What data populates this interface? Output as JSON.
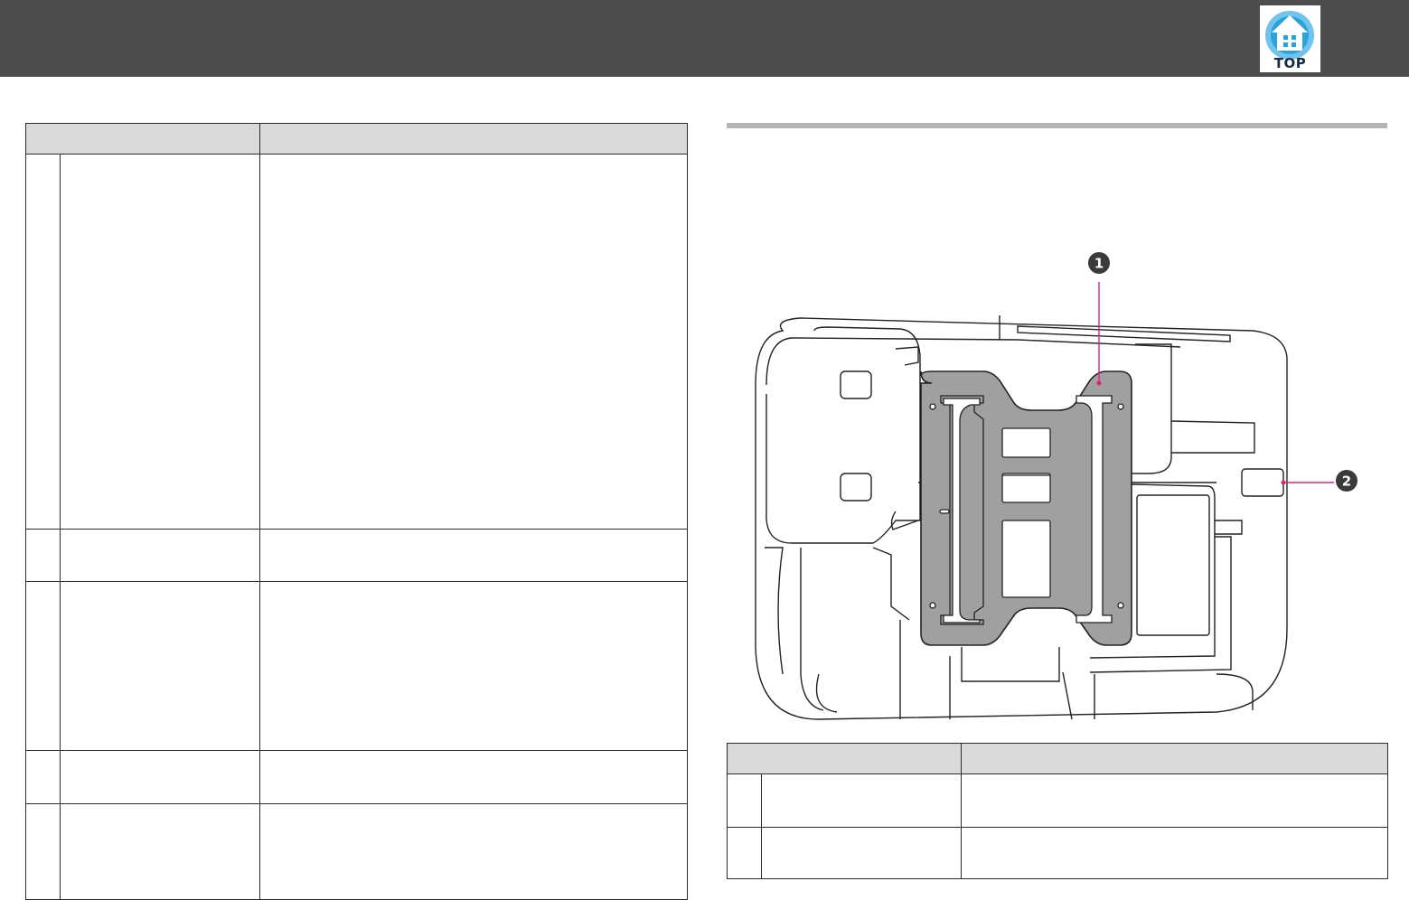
{
  "header": {
    "top_label": "TOP",
    "top_icon": "home-top-icon",
    "bar_color": "#4d4d4d",
    "icon_color": "#29a3d9"
  },
  "left_table": {
    "headers": [
      "",
      ""
    ],
    "rows": [
      {
        "num": "",
        "name": "",
        "desc": ""
      },
      {
        "num": "",
        "name": "",
        "desc": ""
      },
      {
        "num": "",
        "name": "",
        "desc": ""
      },
      {
        "num": "",
        "name": "",
        "desc": ""
      },
      {
        "num": "",
        "name": "",
        "desc": ""
      }
    ]
  },
  "figure": {
    "callouts": [
      "1",
      "2"
    ],
    "callout_line_color": "#e0237a"
  },
  "right_table": {
    "headers": [
      "",
      ""
    ],
    "rows": [
      {
        "num": "",
        "name": "",
        "desc": ""
      },
      {
        "num": "",
        "name": "",
        "desc": ""
      }
    ]
  }
}
